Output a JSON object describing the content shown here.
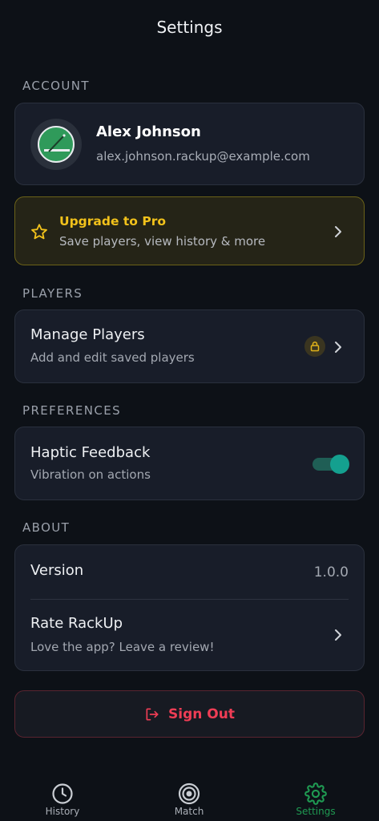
{
  "header": {
    "title": "Settings"
  },
  "sections": {
    "account": "ACCOUNT",
    "players": "PLAYERS",
    "preferences": "PREFERENCES",
    "about": "ABOUT"
  },
  "account": {
    "name": "Alex Johnson",
    "email": "alex.johnson.rackup@example.com",
    "avatar_icon": "pool-table-icon"
  },
  "pro": {
    "title": "Upgrade to Pro",
    "subtitle": "Save players, view history & more",
    "accent": "#f2c21b"
  },
  "players": {
    "title": "Manage Players",
    "subtitle": "Add and edit saved players",
    "locked": true
  },
  "preferences": {
    "haptic_title": "Haptic Feedback",
    "haptic_subtitle": "Vibration on actions",
    "haptic_enabled": true
  },
  "about": {
    "version_label": "Version",
    "version_value": "1.0.0",
    "rate_title": "Rate RackUp",
    "rate_subtitle": "Love the app? Leave a review!"
  },
  "signout": {
    "label": "Sign Out",
    "color": "#ef3d55"
  },
  "tabs": [
    {
      "label": "History",
      "icon": "clock-icon",
      "active": false
    },
    {
      "label": "Match",
      "icon": "target-icon",
      "active": false
    },
    {
      "label": "Settings",
      "icon": "gear-icon",
      "active": true
    }
  ],
  "colors": {
    "background": "#0d1117",
    "card": "#181d29",
    "active_tab": "#1f9a52",
    "toggle_on": "#14a08f"
  }
}
